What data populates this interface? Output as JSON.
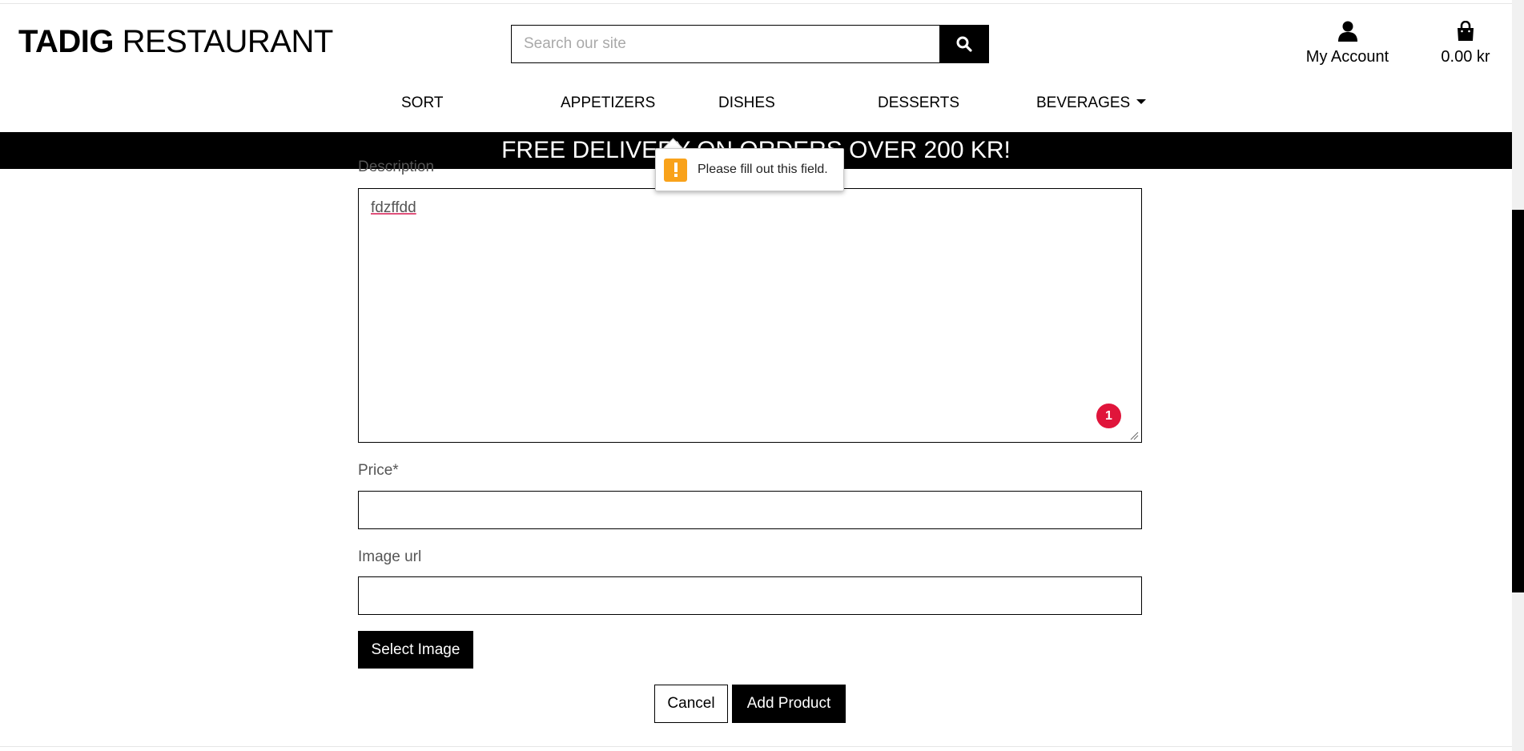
{
  "header": {
    "brand_bold": "TADIG",
    "brand_light": "RESTAURANT",
    "search_placeholder": "Search our site",
    "account_label": "My Account",
    "cart_total": "0.00 kr"
  },
  "nav": {
    "items": [
      {
        "label": "SORT"
      },
      {
        "label": "APPETIZERS"
      },
      {
        "label": "DISHES"
      },
      {
        "label": "DESSERTS"
      },
      {
        "label": "BEVERAGES"
      }
    ]
  },
  "banner": {
    "text": "FREE DELIVERY ON ORDERS OVER 200 KR!"
  },
  "form": {
    "description_label": "Description",
    "description_value": "fdzffdd",
    "price_label": "Price*",
    "price_value": "",
    "image_url_label": "Image url",
    "image_url_value": "",
    "select_image_label": "Select Image",
    "cancel_label": "Cancel",
    "submit_label": "Add Product"
  },
  "validation_tooltip": {
    "message": "Please fill out this field."
  },
  "grammar_badge": {
    "count": "1"
  }
}
